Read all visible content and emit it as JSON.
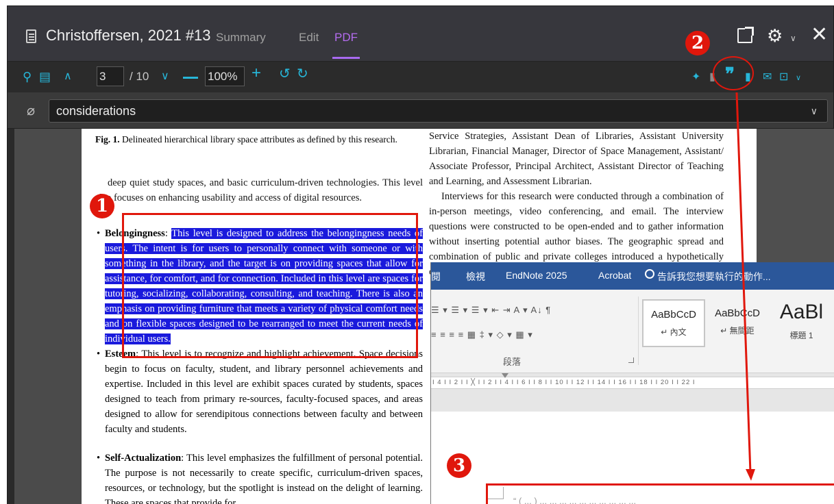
{
  "endnote": {
    "title": "Christoffersen, 2021 #13",
    "tabs": [
      "Summary",
      "Edit",
      "PDF"
    ],
    "active_tab": "PDF",
    "icons": {
      "reference": "reference-icon",
      "open_external": "open-external-icon",
      "settings": "gear-icon",
      "close": "close-icon"
    },
    "toolbar": {
      "page_current": "3",
      "page_total": "/ 10",
      "zoom": "100%",
      "icons": [
        "search-icon",
        "annotation-icon",
        "prev-page-icon",
        "next-page-icon",
        "zoom-out-icon",
        "zoom-in-icon",
        "rotate-left-icon",
        "rotate-right-icon",
        "sparkle-icon",
        "save-icon",
        "quote-icon",
        "copy-icon",
        "mail-icon",
        "export-icon"
      ]
    },
    "search": {
      "value": "considerations",
      "icon": "paperclip-icon"
    }
  },
  "pdf": {
    "caption_bold": "Fig. 1.",
    "caption_text": " Delineated hierarchical library space attributes as defined by this research.",
    "para1": "deep quiet study spaces, and basic curriculum-driven technologies. This level also focuses on enhancing usability and access of digital resources.",
    "belonging_label": "Belongingness",
    "belonging_colon": ": ",
    "belonging_text": "This level is designed to address the belongingness needs of users. The intent is for users to personally connect with someone or with something in the library, and the target is on providing spaces that allow for assistance, for comfort, and for connection. Included in this level are spaces for tutoring, socializing, collaborating, consulting, and teaching. There is also an emphasis on providing furniture that meets a variety of physical comfort needs and on flexible spaces designed to be rearranged to meet the current needs of individual users.",
    "esteem_label": "Esteem",
    "esteem_text": ": This level is to recognize and highlight achievement. Space decisions begin to focus on faculty, student, and library personnel achievements and expertise. Included in this level are exhibit spaces curated by students, spaces designed to teach from primary re-sources, faculty-focused spaces, and areas designed to allow for serendipitous connections between faculty and between faculty and students.",
    "selfact_label": "Self-Actualization",
    "selfact_text": ": This level emphasizes the fulfillment of personal potential. The purpose is not necessarily to create specific, curriculum-driven spaces, resources, or technology, but the spotlight is instead on the delight of learning. These are spaces that provide for",
    "right_para1": "Service Strategies, Assistant Dean of Libraries, Assistant University Librarian, Financial Manager, Director of Space Management, Assistant/ Associate Professor, Principal Architect, Assistant Director of Teaching and Learning, and Assessment Librarian.",
    "right_para2": "Interviews for this research were conducted through a combination of in-person meetings, video conferencing, and email. The interview questions were constructed to be open-ended and to gather information without inserting potential author biases. The geographic spread and combination of public and private colleges introduced a hypothetically diverse audience while limiting the need to focus on any one area."
  },
  "word": {
    "ribbon_tabs": [
      "閱",
      "檢視",
      "EndNote 2025",
      "Acrobat"
    ],
    "tell_me": "告訴我您想要執行的動作...",
    "paragraph_label": "段落",
    "styles": [
      {
        "sample": "AaBbCcD",
        "name": "↵ 內文"
      },
      {
        "sample": "AaBbCcD",
        "name": "↵ 無間距"
      },
      {
        "sample": "AaBl",
        "name": "標題 1"
      }
    ],
    "ruler": "I 4 I   I 2 I   I ╳ I   I 2 I   I 4 I   I 6 I   I 8 I   I 10 I   I 12 I   I 14 I   I 16 I   I 18 I   I 20 I   I 22 I",
    "ribbon_row1": "☰ ▾ ☰ ▾ ☰ ▾  ⇤ ⇥  A ▾   A↓  ¶",
    "ribbon_row2": "≡ ≡ ≡ ≡ ▦  ‡ ▾  ◇ ▾ ▦ ▾",
    "pasted_preview": "“ ( ... ) ... ... ... ... ... ... ... ... ... ..."
  },
  "annotations": {
    "badge1": "1",
    "badge2": "2",
    "badge3": "3"
  },
  "colors": {
    "highlight": "#1a1adc",
    "annotation_red": "#e0170c",
    "pdf_tab": "#b46cf0",
    "toolbar_icon": "#27b6d8",
    "word_ribbon": "#2b579a"
  }
}
